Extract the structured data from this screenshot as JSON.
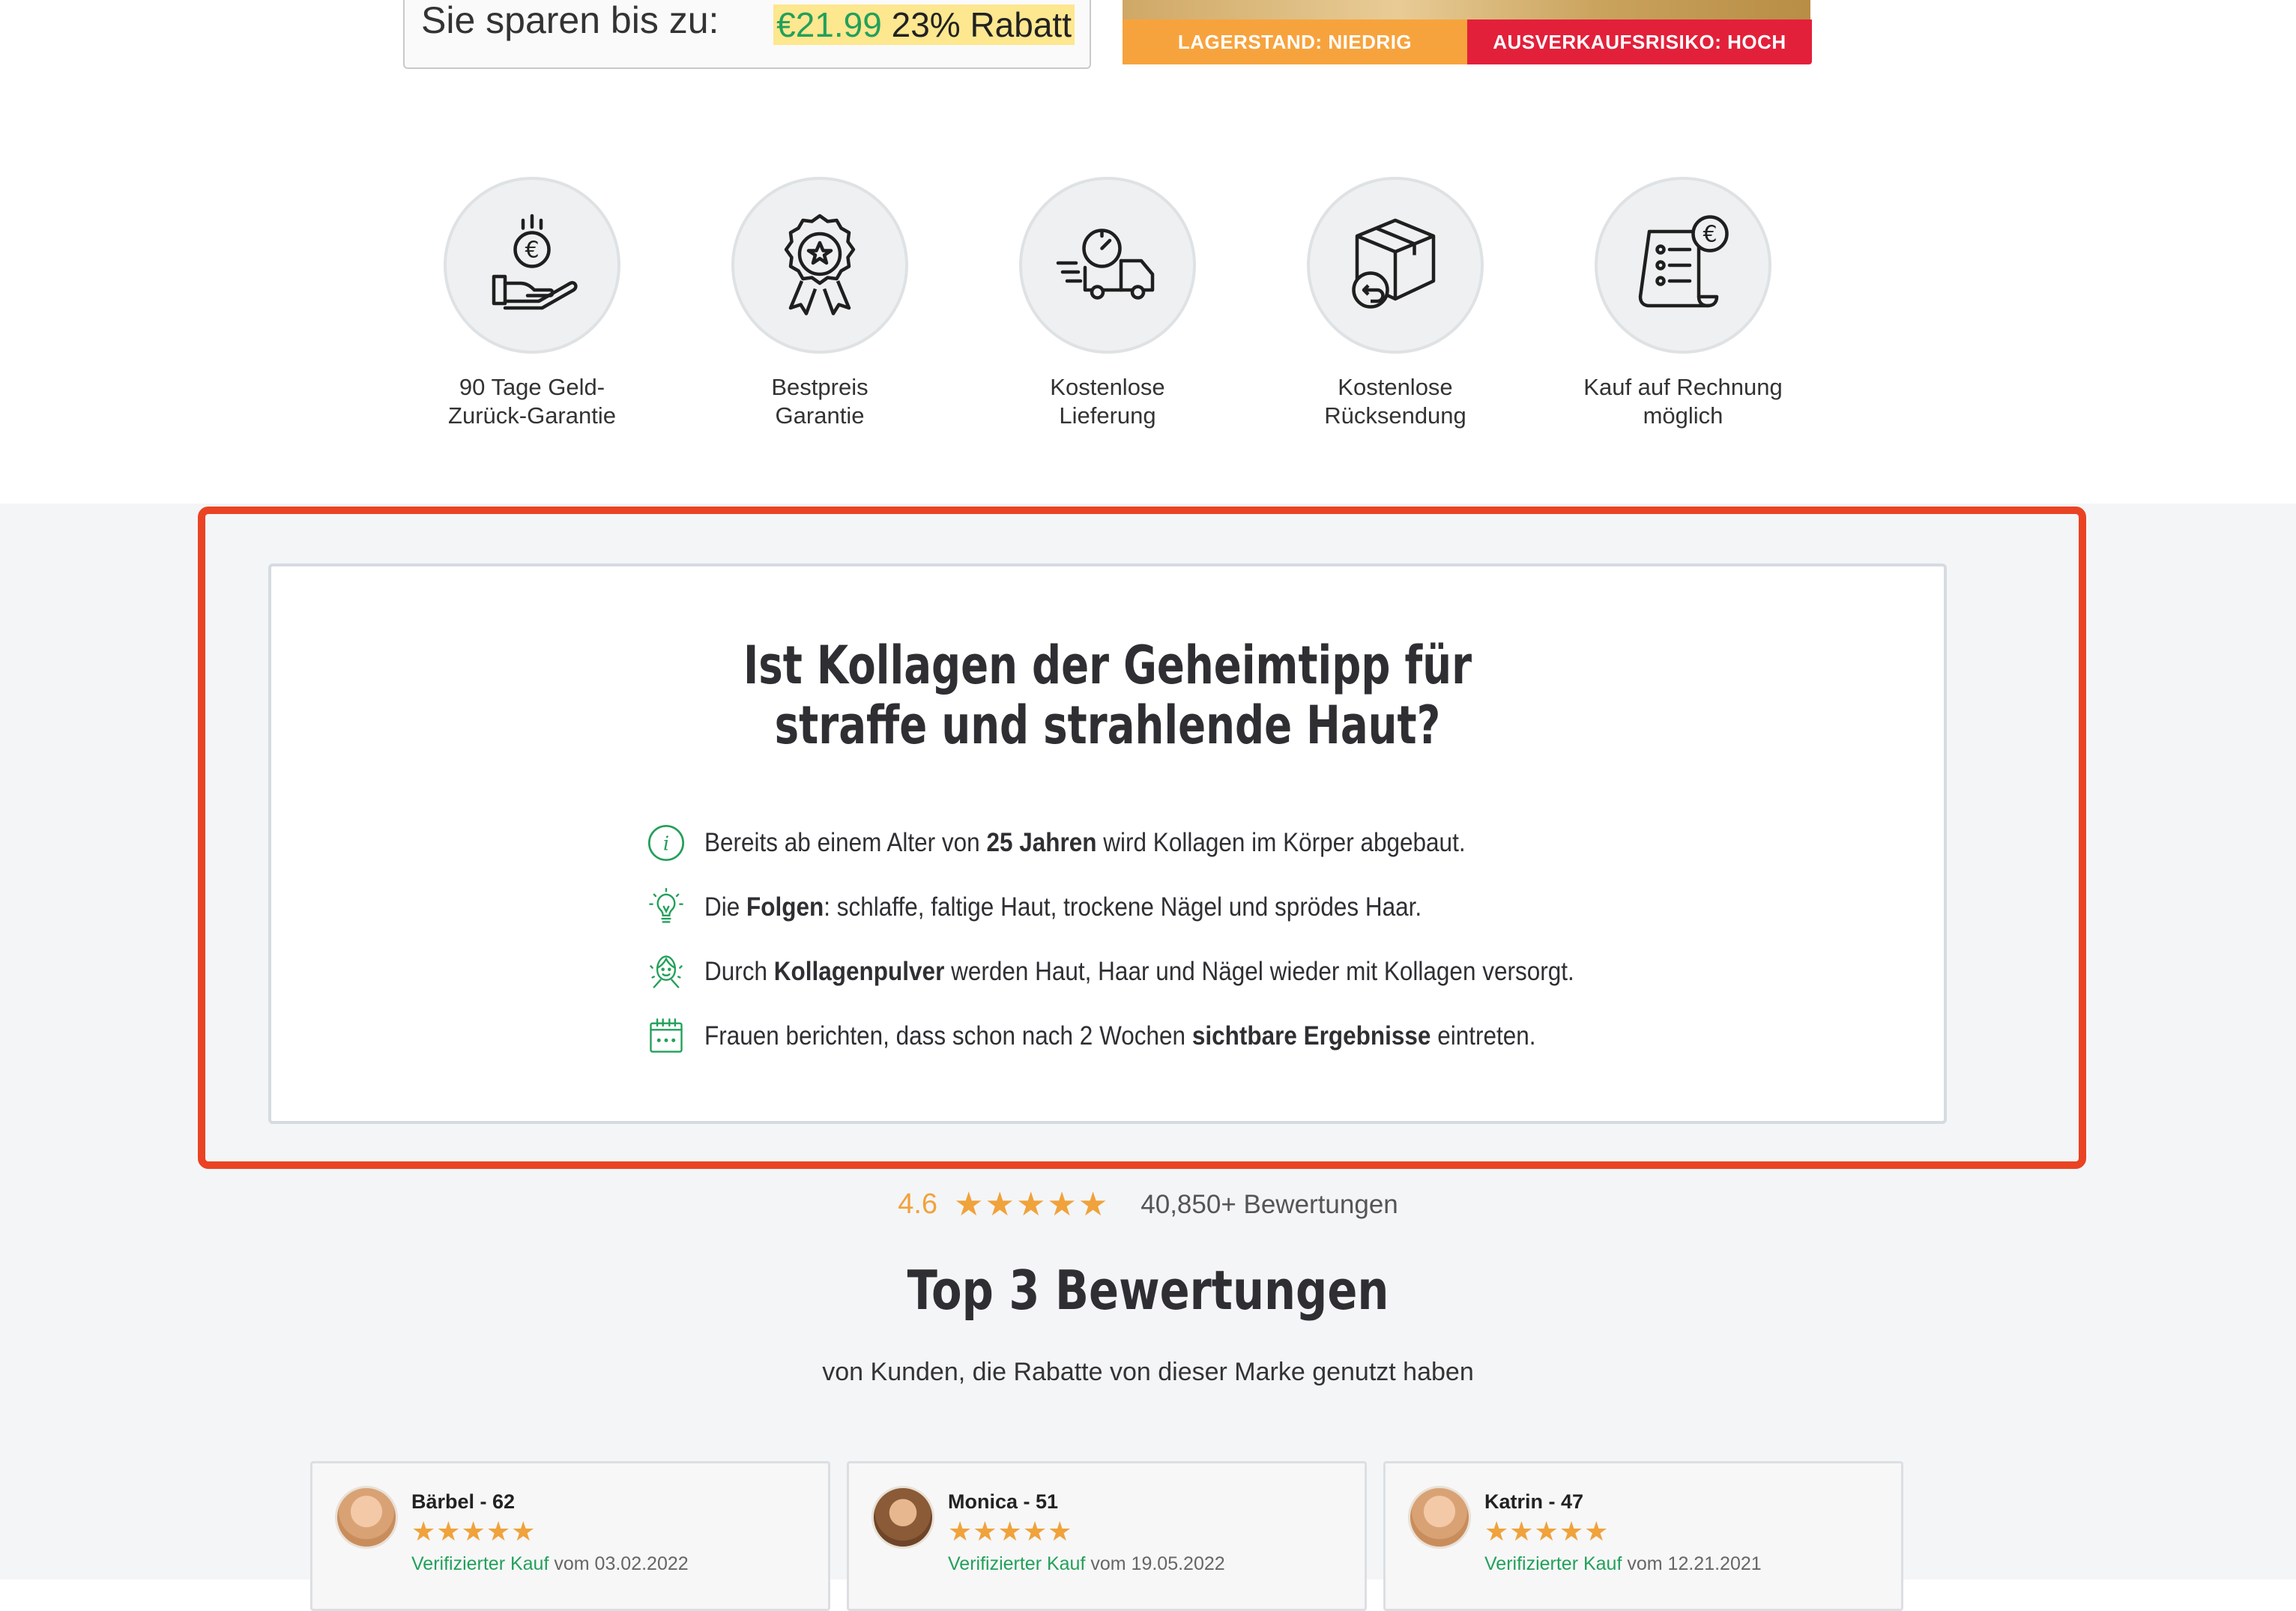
{
  "savings": {
    "label": "Sie sparen bis zu:",
    "price": "€21.99",
    "discount": "23% Rabatt"
  },
  "stock": {
    "low_label": "LAGERSTAND: NIEDRIG",
    "risk_label": "AUSVERKAUFSRISIKO: HOCH"
  },
  "features": [
    {
      "line1": "90 Tage Geld-",
      "line2": "Zurück-Garantie",
      "icon": "money-back-hand-icon"
    },
    {
      "line1": "Bestpreis",
      "line2": "Garantie",
      "icon": "award-badge-icon"
    },
    {
      "line1": "Kostenlose",
      "line2": "Lieferung",
      "icon": "delivery-truck-icon"
    },
    {
      "line1": "Kostenlose",
      "line2": "Rücksendung",
      "icon": "return-box-icon"
    },
    {
      "line1": "Kauf auf Rechnung",
      "line2": "möglich",
      "icon": "invoice-euro-icon"
    }
  ],
  "info": {
    "title_line1": "Ist Kollagen der Geheimtipp für",
    "title_line2": "straffe und strahlende Haut?",
    "items": [
      {
        "icon": "info-icon",
        "pre": "Bereits ab einem Alter von ",
        "bold": "25 Jahren",
        "post": " wird Kollagen im Körper abgebaut."
      },
      {
        "icon": "lightbulb-icon",
        "pre": "Die ",
        "bold": "Folgen",
        "post": ": schlaffe, faltige Haut, trockene Nägel und sprödes Haar."
      },
      {
        "icon": "face-care-icon",
        "pre": "Durch ",
        "bold": "Kollagenpulver",
        "post": " werden Haut, Haar und Nägel wieder mit Kollagen versorgt."
      },
      {
        "icon": "calendar-icon",
        "pre": "Frauen berichten, dass schon nach 2 Wochen ",
        "bold": "sichtbare Ergebnisse",
        "post": " eintreten."
      }
    ]
  },
  "rating": {
    "score": "4.6",
    "stars": "★★★★★",
    "count": "40,850+ Bewertungen"
  },
  "reviews": {
    "title": "Top 3 Bewertungen",
    "subtitle": "von Kunden, die Rabatte von dieser Marke genutzt haben",
    "items": [
      {
        "name": "Bärbel - 62",
        "stars": "★★★★★",
        "verified": "Verifizierter Kauf",
        "date": " vom 03.02.2022"
      },
      {
        "name": "Monica - 51",
        "stars": "★★★★★",
        "verified": "Verifizierter Kauf",
        "date": " vom 19.05.2022"
      },
      {
        "name": "Katrin - 47",
        "stars": "★★★★★",
        "verified": "Verifizierter Kauf",
        "date": " vom 12.21.2021"
      }
    ]
  },
  "colors": {
    "accent_green": "#23a05a",
    "star_orange": "#f0a23b",
    "stock_low": "#f7a33d",
    "stock_risk": "#e3203a",
    "highlight_frame": "#ea4323"
  }
}
